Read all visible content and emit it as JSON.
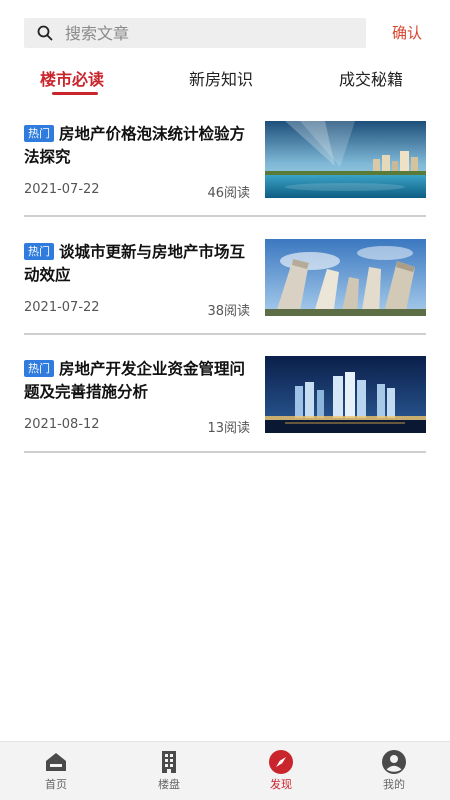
{
  "search": {
    "placeholder": "搜索文章",
    "confirm_label": "确认"
  },
  "tabs": [
    {
      "label": "楼市必读",
      "active": true
    },
    {
      "label": "新房知识",
      "active": false
    },
    {
      "label": "成交秘籍",
      "active": false
    }
  ],
  "articles": [
    {
      "badge": "热门",
      "title": "房地产价格泡沫统计检验方法探究",
      "date": "2021-07-22",
      "reads": "46阅读",
      "image": "waterfront-city-skyline"
    },
    {
      "badge": "热门",
      "title": "谈城市更新与房地产市场互动效应",
      "date": "2021-07-22",
      "reads": "38阅读",
      "image": "high-rise-towers-sky"
    },
    {
      "badge": "热门",
      "title": "房地产开发企业资金管理问题及完善措施分析",
      "date": "2021-08-12",
      "reads": "13阅读",
      "image": "night-city-towers"
    }
  ],
  "nav": [
    {
      "label": "首页",
      "icon": "home-icon",
      "active": false
    },
    {
      "label": "楼盘",
      "icon": "building-icon",
      "active": false
    },
    {
      "label": "发现",
      "icon": "compass-icon",
      "active": true
    },
    {
      "label": "我的",
      "icon": "user-icon",
      "active": false
    }
  ],
  "colors": {
    "accent": "#c9252c",
    "confirm": "#d9462f",
    "badge": "#2f7bde",
    "nav_bg": "#f3f3f3"
  }
}
